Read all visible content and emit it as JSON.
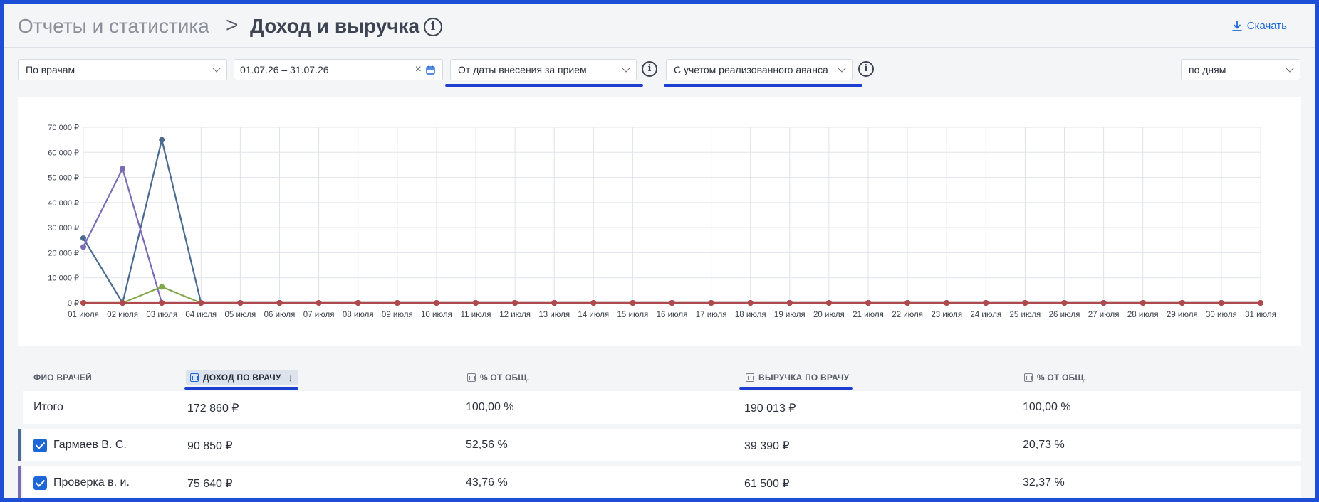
{
  "header": {
    "breadcrumb_parent": "Отчеты и статистика",
    "breadcrumb_separator": ">",
    "title": "Доход и выручка",
    "info_icon": "info-icon",
    "download_label": "Скачать",
    "download_icon": "download-icon"
  },
  "filters": {
    "group_by": "По врачам",
    "date_range": "01.07.26 – 31.07.26",
    "clear_symbol": "×",
    "date_mode": "От даты внесения за прием",
    "advance_mode": "С учетом реализованного аванса",
    "period": "по дням"
  },
  "chart_data": {
    "type": "line",
    "x": [
      "01 июля",
      "02 июля",
      "03 июля",
      "04 июля",
      "05 июля",
      "06 июля",
      "07 июля",
      "08 июля",
      "09 июля",
      "10 июля",
      "11 июля",
      "12 июля",
      "13 июля",
      "14 июля",
      "15 июля",
      "16 июля",
      "17 июля",
      "18 июля",
      "19 июля",
      "20 июля",
      "21 июля",
      "22 июля",
      "23 июля",
      "24 июля",
      "25 июля",
      "26 июля",
      "27 июля",
      "28 июля",
      "29 июля",
      "30 июля",
      "31 июля"
    ],
    "y_ticks": [
      "0 ₽",
      "10 000 ₽",
      "20 000 ₽",
      "30 000 ₽",
      "40 000 ₽",
      "50 000 ₽",
      "60 000 ₽",
      "70 000 ₽"
    ],
    "ylim": [
      0,
      70000
    ],
    "grid": true,
    "series": [
      {
        "color": "#4a6a8f",
        "values": [
          25800,
          0,
          65000,
          0,
          0,
          0,
          0,
          0,
          0,
          0,
          0,
          0,
          0,
          0,
          0,
          0,
          0,
          0,
          0,
          0,
          0,
          0,
          0,
          0,
          0,
          0,
          0,
          0,
          0,
          0,
          0
        ]
      },
      {
        "color": "#7b6bb5",
        "values": [
          22300,
          53500,
          0,
          0,
          0,
          0,
          0,
          0,
          0,
          0,
          0,
          0,
          0,
          0,
          0,
          0,
          0,
          0,
          0,
          0,
          0,
          0,
          0,
          0,
          0,
          0,
          0,
          0,
          0,
          0,
          0
        ]
      },
      {
        "color": "#7ea84a",
        "values": [
          0,
          0,
          6400,
          0,
          0,
          0,
          0,
          0,
          0,
          0,
          0,
          0,
          0,
          0,
          0,
          0,
          0,
          0,
          0,
          0,
          0,
          0,
          0,
          0,
          0,
          0,
          0,
          0,
          0,
          0,
          0
        ]
      },
      {
        "color": "#b0494e",
        "values": [
          0,
          0,
          0,
          0,
          0,
          0,
          0,
          0,
          0,
          0,
          0,
          0,
          0,
          0,
          0,
          0,
          0,
          0,
          0,
          0,
          0,
          0,
          0,
          0,
          0,
          0,
          0,
          0,
          0,
          0,
          0
        ]
      }
    ]
  },
  "table": {
    "columns": {
      "doctor": "ФИО ВРАЧЕЙ",
      "income": "ДОХОД ПО ВРАЧУ",
      "income_pct": "% ОТ ОБЩ.",
      "revenue": "ВЫРУЧКА ПО ВРАЧУ",
      "revenue_pct": "% ОТ ОБЩ."
    },
    "sort_arrow": "↓",
    "total": {
      "name": "Итого",
      "income": "172 860 ₽",
      "income_pct": "100,00 %",
      "revenue": "190 013 ₽",
      "revenue_pct": "100,00 %"
    },
    "rows": [
      {
        "name": "Гармаев В. С.",
        "income": "90 850 ₽",
        "income_pct": "52,56 %",
        "revenue": "39 390 ₽",
        "revenue_pct": "20,73 %",
        "color": "#4a6a8f"
      },
      {
        "name": "Проверка в. и.",
        "income": "75 640 ₽",
        "income_pct": "43,76 %",
        "revenue": "61 500 ₽",
        "revenue_pct": "32,37 %",
        "color": "#7b6bb5"
      }
    ]
  }
}
